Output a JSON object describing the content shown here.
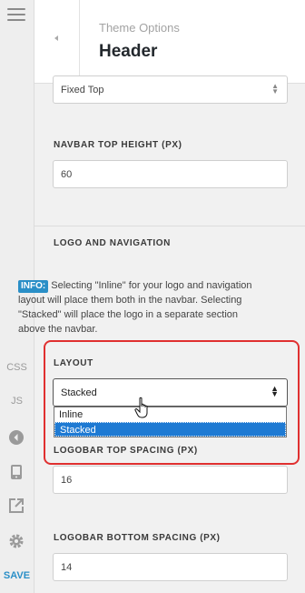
{
  "rail": {
    "css_label": "CSS",
    "js_label": "JS",
    "save_label": "SAVE",
    "icons": [
      "menu-icon",
      "back-circle-icon",
      "mobile-device-icon",
      "external-link-icon",
      "gear-icon"
    ]
  },
  "header": {
    "breadcrumb": "Theme Options",
    "title": "Header"
  },
  "navbar": {
    "position_value": "Fixed Top",
    "top_height_label": "NAVBAR TOP HEIGHT (PX)",
    "top_height_value": "60"
  },
  "logo_nav": {
    "heading": "LOGO AND NAVIGATION",
    "info_badge": "INFO:",
    "info_text": " Selecting \"Inline\" for your logo and navigation layout will place them both in the navbar. Selecting \"Stacked\" will place the logo in a separate section above the navbar.",
    "layout_label": "LAYOUT",
    "layout_value": "Stacked",
    "layout_options": [
      "Inline",
      "Stacked"
    ],
    "top_spacing_label": "LOGOBAR TOP SPACING (PX)",
    "top_spacing_value": "16",
    "bottom_spacing_label": "LOGOBAR BOTTOM SPACING (PX)",
    "bottom_spacing_value": "14"
  },
  "colors": {
    "accent": "#2a8fc7",
    "highlight": "#e03030",
    "selected_option": "#1e7ad3"
  }
}
